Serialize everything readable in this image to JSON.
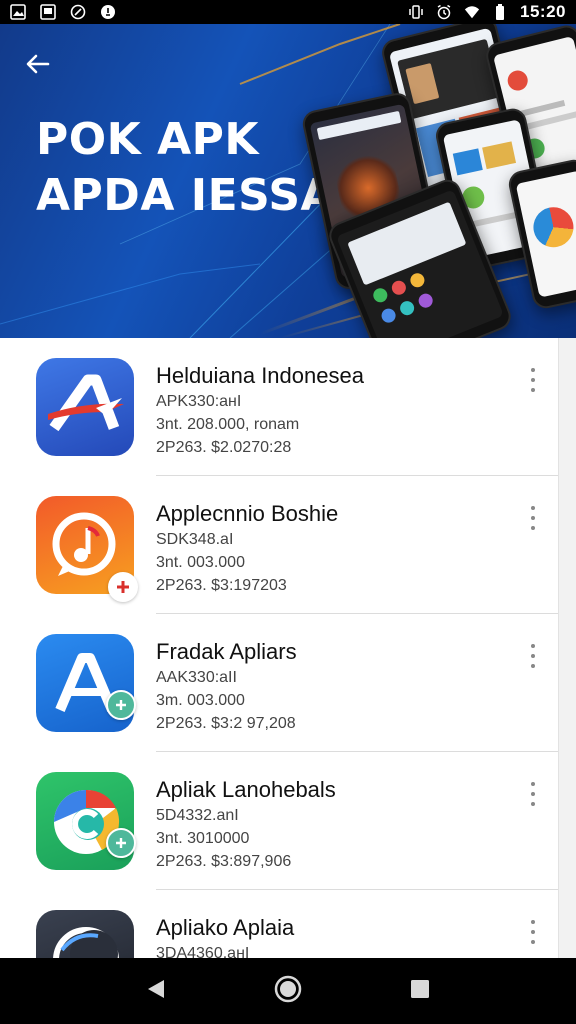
{
  "status_bar": {
    "time": "15:20",
    "left_icons": [
      "image-icon",
      "document-icon",
      "whatsapp-icon",
      "notification-icon"
    ],
    "right_icons": [
      "vibrate-icon",
      "alarm-icon",
      "wifi-icon",
      "battery-icon"
    ]
  },
  "header": {
    "title_line1": "POK APK",
    "title_line2": "APDA IESSA",
    "back_icon": "arrow-back-icon"
  },
  "apps": [
    {
      "name": "Helduiana Indonesea",
      "line1": "APK330:aнI",
      "line2": "3nt. 208.000, ronam",
      "line3": "2P263. $2.0270:28",
      "icon": "app-a-red-icon",
      "badge": null
    },
    {
      "name": "Applecnnio Boshie",
      "line1": "SDK348.aI",
      "line2": "3nt. 003.000",
      "line3": "2P263. $3:197203",
      "icon": "music-note-icon",
      "badge": "red-plus-badge"
    },
    {
      "name": "Fradak Apliars",
      "line1": "AAK330:aII",
      "line2": "3m. 003.000",
      "line3": "2P263. $3:2 97,208",
      "icon": "app-a-white-icon",
      "badge": "teal-plus-badge"
    },
    {
      "name": "Apliak Lanohebals",
      "line1": "5D4332.anI",
      "line2": "3nt. 3010000",
      "line3": "2P263. $3:897,906",
      "icon": "chrome-c-icon",
      "badge": "teal-plus-badge"
    },
    {
      "name": "Apliako Aplaia",
      "line1": "3DA4360.aнI",
      "line2": "",
      "line3": "",
      "icon": "moon-icon",
      "badge": null
    }
  ],
  "colors": {
    "banner": "#1453b8",
    "app1_bg": "#2a59c9",
    "app2_bg": "#f06a28",
    "app3_bg": "#1a74e0",
    "app4_bg": "#24b56a",
    "app5_bg": "#2a2f3a",
    "teal_badge": "#4fb89b",
    "red_badge": "#d9302c"
  },
  "nav": {
    "icons": [
      "back-triangle-icon",
      "home-circle-icon",
      "recents-square-icon"
    ]
  }
}
